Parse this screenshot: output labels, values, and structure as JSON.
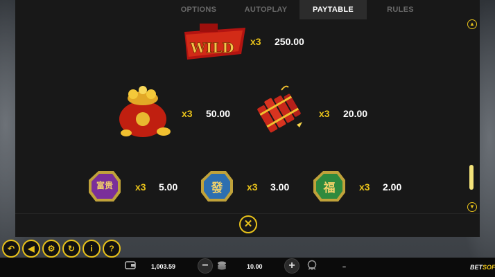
{
  "tabs": [
    "OPTIONS",
    "AUTOPLAY",
    "PAYTABLE",
    "RULES"
  ],
  "active_tab": "PAYTABLE",
  "paytable": {
    "wild": {
      "label": "WILD",
      "mult": "x3",
      "value": "250.00"
    },
    "moneybag": {
      "mult": "x3",
      "value": "50.00"
    },
    "firecracker": {
      "mult": "x3",
      "value": "20.00"
    },
    "tile_purple": {
      "glyph": "富贵",
      "mult": "x3",
      "value": "5.00"
    },
    "tile_blue": {
      "glyph": "發",
      "mult": "x3",
      "value": "3.00"
    },
    "tile_green": {
      "glyph": "福",
      "mult": "x3",
      "value": "2.00"
    }
  },
  "bottom": {
    "balance": "1,003.59",
    "bet": "10.00",
    "win": "–",
    "logo_a": "BET",
    "logo_b": "SOFT"
  },
  "colors": {
    "accent": "#e8c21a",
    "panel": "#181818"
  }
}
